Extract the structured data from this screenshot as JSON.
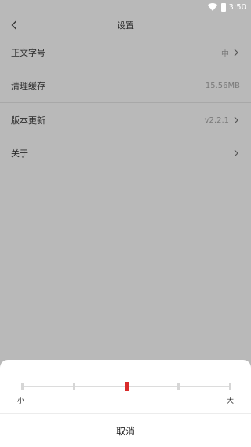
{
  "status_bar": {
    "time": "3:50"
  },
  "header": {
    "title": "设置"
  },
  "settings": [
    {
      "label": "正文字号",
      "value": "中"
    },
    {
      "label": "清理缓存",
      "value": "15.56MB"
    },
    {
      "label": "版本更新",
      "value": "v2.2.1"
    },
    {
      "label": "关于",
      "value": ""
    }
  ],
  "font_sheet": {
    "min_label": "小",
    "max_label": "大",
    "levels": 5,
    "selected_level": 3,
    "accent_color": "#d92b2b",
    "cancel_label": "取消"
  },
  "icons": [
    "wifi-icon",
    "battery-icon",
    "back-arrow-icon",
    "chevron-right-icon"
  ]
}
